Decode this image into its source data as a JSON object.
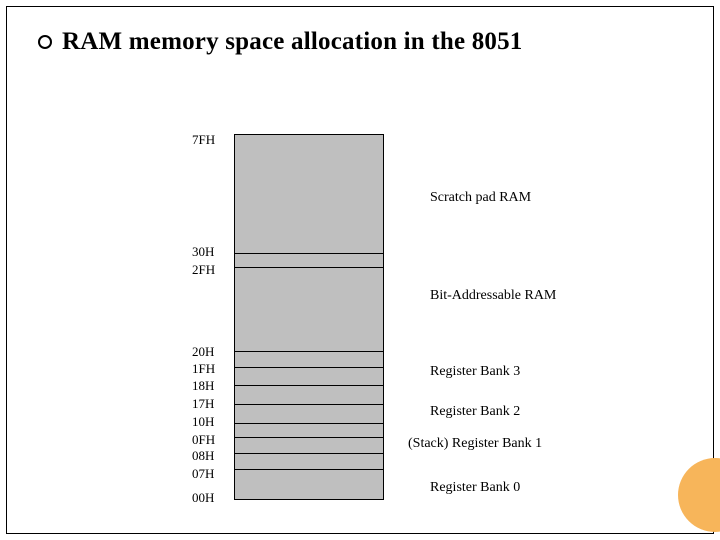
{
  "title": "RAM memory space allocation in the 8051",
  "addresses": {
    "a7F": "7FH",
    "a30": "30H",
    "a2F": "2FH",
    "a20": "20H",
    "a1F": "1FH",
    "a18": "18H",
    "a17": "17H",
    "a10": "10H",
    "a0F": "0FH",
    "a08": "08H",
    "a07": "07H",
    "a00": "00H"
  },
  "regions": {
    "scratch": "Scratch pad RAM",
    "bitaddr": "Bit-Addressable RAM",
    "bank3": "Register Bank 3",
    "bank2": "Register Bank 2",
    "bank1": "(Stack)  Register Bank 1",
    "bank0": "Register Bank 0"
  },
  "colors": {
    "blockFill": "#bfbfbf",
    "accent": "#f7b55a"
  },
  "icons": {
    "bullet": "open-circle"
  }
}
